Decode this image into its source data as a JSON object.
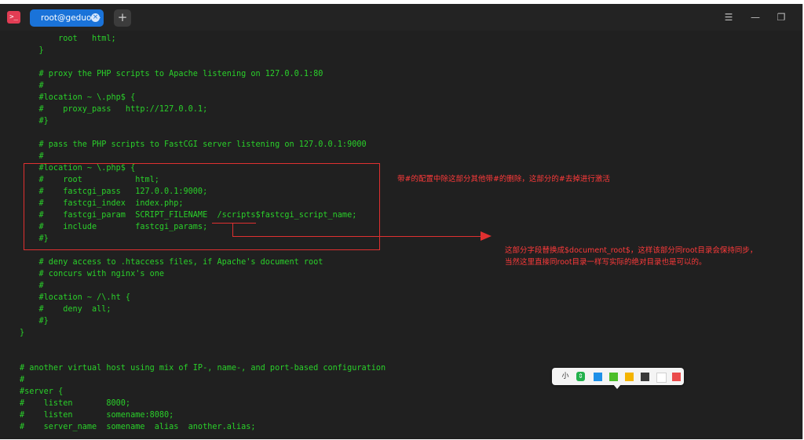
{
  "titlebar": {
    "app_icon_glyph": ">_",
    "app_icon_name": "terminal-icon",
    "tab_title": "root@geduo:~",
    "tab_close_glyph": "×",
    "new_tab_glyph": "+",
    "menu_glyph": "☰",
    "minimize_glyph": "—",
    "maximize_glyph": "❐"
  },
  "terminal_lines": [
    "        root   html;",
    "    }",
    "",
    "    # proxy the PHP scripts to Apache listening on 127.0.0.1:80",
    "    #",
    "    #location ~ \\.php$ {",
    "    #    proxy_pass   http://127.0.0.1;",
    "    #}",
    "",
    "    # pass the PHP scripts to FastCGI server listening on 127.0.0.1:9000",
    "    #",
    "    #location ~ \\.php$ {",
    "    #    root           html;",
    "    #    fastcgi_pass   127.0.0.1:9000;",
    "    #    fastcgi_index  index.php;",
    "    #    fastcgi_param  SCRIPT_FILENAME  /scripts$fastcgi_script_name;",
    "    #    include        fastcgi_params;",
    "    #}",
    "",
    "    # deny access to .htaccess files, if Apache's document root",
    "    # concurs with nginx's one",
    "    #",
    "    #location ~ /\\.ht {",
    "    #    deny  all;",
    "    #}",
    "}",
    "",
    "",
    "# another virtual host using mix of IP-, name-, and port-based configuration",
    "#",
    "#server {",
    "#    listen       8000;",
    "#    listen       somename:8080;",
    "#    server_name  somename  alias  another.alias;"
  ],
  "annotations": {
    "note1": "带#的配置中除这部分其他带#的删除，这部分的#去掉进行激活",
    "note2_line1": "这部分字段替换成$document_root$，这样该部分同root目录会保持同步，",
    "note2_line2": "当然这里直接同root目录一样写实际的绝对目录也是可以的。"
  },
  "colors": {
    "terminal_bg": "#202020",
    "terminal_text": "#2ad02a",
    "annotation_red": "#e03030",
    "tab_blue": "#1a73d9"
  },
  "draw_toolbar": {
    "size_label": "小",
    "swatches": [
      {
        "name": "blue-swatch",
        "color": "#1e90e8"
      },
      {
        "name": "green-swatch",
        "color": "#4cbe2a"
      },
      {
        "name": "yellow-swatch",
        "color": "#f4b400"
      },
      {
        "name": "dark-gray-swatch",
        "color": "#3a3a3a"
      },
      {
        "name": "white-swatch",
        "color": "#ffffff"
      },
      {
        "name": "red-swatch",
        "color": "#ea4b4b"
      }
    ]
  }
}
